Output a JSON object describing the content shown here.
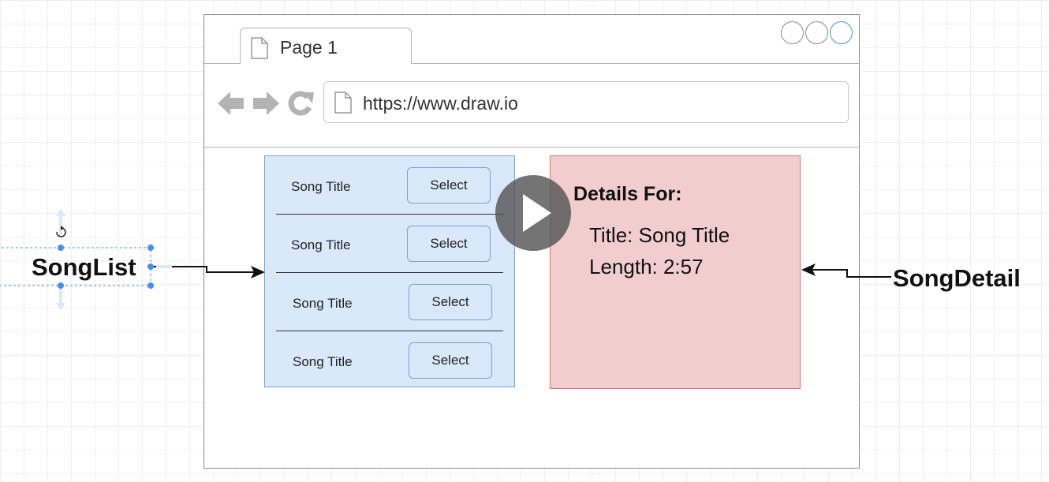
{
  "browser": {
    "tab_label": "Page 1",
    "url": "https://www.draw.io",
    "icons": {
      "back": "arrow-left-icon",
      "forward": "arrow-right-icon",
      "reload": "reload-icon",
      "document": "document-icon"
    }
  },
  "song_list": {
    "rows": [
      {
        "title": "Song Title",
        "button": "Select"
      },
      {
        "title": "Song Title",
        "button": "Select"
      },
      {
        "title": "Song Title",
        "button": "Select"
      },
      {
        "title": "Song Title",
        "button": "Select"
      }
    ]
  },
  "song_detail": {
    "heading": "Details For:",
    "title_line": "Title: Song Title",
    "length_line": "Length: 2:57"
  },
  "labels": {
    "song_list": "SongList",
    "song_detail": "SongDetail"
  },
  "colors": {
    "list_fill": "#dae8fc",
    "list_border": "#7e9fd2",
    "detail_fill": "#f2cdcd",
    "detail_border": "#c97878",
    "selection": "#4a90e2"
  },
  "overlay": {
    "icon": "play-icon"
  }
}
